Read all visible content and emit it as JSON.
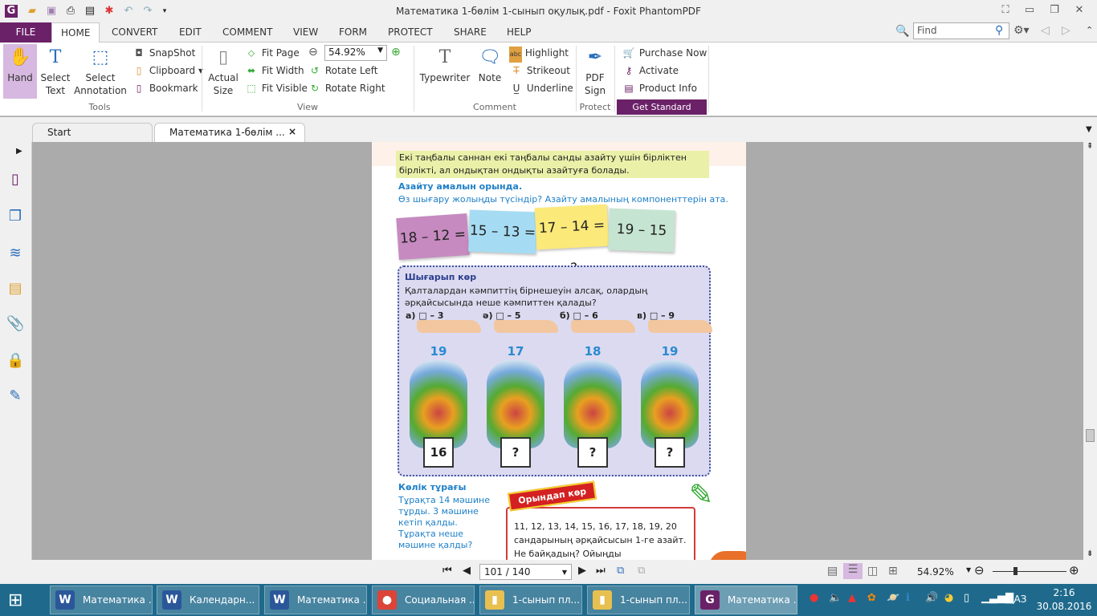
{
  "window": {
    "title": "Математика 1-бөлім 1-сынып оқулық.pdf - Foxit PhantomPDF"
  },
  "menu": {
    "tabs": [
      "FILE",
      "HOME",
      "CONVERT",
      "EDIT",
      "COMMENT",
      "VIEW",
      "FORM",
      "PROTECT",
      "SHARE",
      "HELP"
    ],
    "find_placeholder": "Find"
  },
  "ribbon": {
    "tools": {
      "hand": "Hand",
      "select_text": "Select Text",
      "select_annotation": "Select Annotation",
      "snapshot": "SnapShot",
      "clipboard": "Clipboard",
      "bookmark": "Bookmark",
      "group": "Tools"
    },
    "view": {
      "actual_size": "Actual Size",
      "fit_page": "Fit Page",
      "fit_width": "Fit Width",
      "fit_visible": "Fit Visible",
      "zoom": "54.92%",
      "rotate_left": "Rotate Left",
      "rotate_right": "Rotate Right",
      "group": "View"
    },
    "comment": {
      "typewriter": "Typewriter",
      "note": "Note",
      "highlight": "Highlight",
      "strikeout": "Strikeout",
      "underline": "Underline",
      "group": "Comment"
    },
    "protect": {
      "pdf_sign": "PDF Sign",
      "group": "Protect"
    },
    "standard": {
      "purchase": "Purchase Now",
      "activate": "Activate",
      "product_info": "Product Info",
      "get_standard": "Get Standard"
    }
  },
  "doc_tabs": [
    "Start",
    "Математика 1-бөлім ..."
  ],
  "page": {
    "rule": "Екі таңбалы саннан екі таңбалы санды азайту үшін бірліктен бірлікті, ал ондықтан ондықты азайтуға болады.",
    "task_title": "Азайту амалын орында.",
    "task_sub": "Өз шығару жолыңды түсіндір? Азайту амалының компоненттерін ата.",
    "cards": [
      {
        "text": "18 – 12 = ?",
        "color": "#c68ac0"
      },
      {
        "text": "15 – 13 = ?",
        "color": "#a6dcf3"
      },
      {
        "text": "17 – 14 = ?",
        "color": "#fbe97a"
      },
      {
        "text": "19 – 15 = ?",
        "color": "#c6e4d2"
      }
    ],
    "try_title": "Шығарып көр",
    "try_text": "Қалталардан кәмпиттің бірнешеуін алсақ, олардың әрқайсысында неше кәмпиттен қалады?",
    "bags": [
      {
        "label": "а) □ – 3",
        "count": "19",
        "answer": "16"
      },
      {
        "label": "ә) □ – 5",
        "count": "17",
        "answer": "?"
      },
      {
        "label": "б) □ – 6",
        "count": "18",
        "answer": "?"
      },
      {
        "label": "в) □ – 9",
        "count": "19",
        "answer": "?"
      }
    ],
    "parking_title": "Көлік тұрағы",
    "parking_text": "Тұрақта 14 мәшине тұрды. 3 мәшине кетіп қалды. Тұрақта неше мәшине қалды?",
    "do_banner": "Орындап көр",
    "do_text": "11, 12, 13, 14, 15, 16, 17, 18, 19, 20 сандарының әрқайсысын 1-ге азайт. Не байқадың? Ойыңды қорытындыла."
  },
  "status": {
    "page_input": "101 / 140",
    "zoom": "54.92%",
    "zoom_slider": 0.3
  },
  "taskbar": {
    "items": [
      {
        "label": "Математика ...",
        "icon": "W",
        "color": "#2b579a"
      },
      {
        "label": "Календарн...",
        "icon": "W",
        "color": "#2b579a"
      },
      {
        "label": "Математика ...",
        "icon": "W",
        "color": "#2b579a"
      },
      {
        "label": "Социальная ...",
        "icon": "●",
        "color": "#db4437"
      },
      {
        "label": "1-сынып пл...",
        "icon": "▮",
        "color": "#e8c050"
      },
      {
        "label": "1-сынып пл...",
        "icon": "▮",
        "color": "#e8c050"
      },
      {
        "label": "Математика ...",
        "icon": "G",
        "color": "#6b2168"
      }
    ],
    "lang": "ҚАЗ",
    "time": "2:16",
    "date": "30.08.2016"
  }
}
